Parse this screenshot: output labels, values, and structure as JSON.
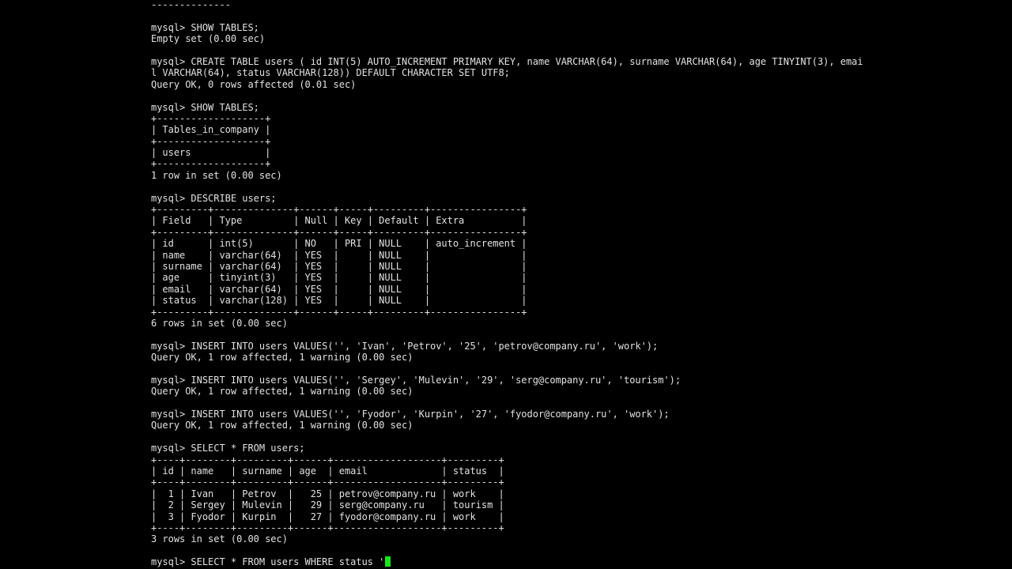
{
  "terminal": {
    "background": "#000000",
    "foreground": "#e2e2e2",
    "cursor_color": "#19e619",
    "lines": [
      "--------------",
      "",
      "mysql> SHOW TABLES;",
      "Empty set (0.00 sec)",
      "",
      "mysql> CREATE TABLE users ( id INT(5) AUTO_INCREMENT PRIMARY KEY, name VARCHAR(64), surname VARCHAR(64), age TINYINT(3), emai",
      "l VARCHAR(64), status VARCHAR(128)) DEFAULT CHARACTER SET UTF8;",
      "Query OK, 0 rows affected (0.01 sec)",
      "",
      "mysql> SHOW TABLES;",
      "+-------------------+",
      "| Tables_in_company |",
      "+-------------------+",
      "| users             |",
      "+-------------------+",
      "1 row in set (0.00 sec)",
      "",
      "mysql> DESCRIBE users;",
      "+---------+--------------+------+-----+---------+----------------+",
      "| Field   | Type         | Null | Key | Default | Extra          |",
      "+---------+--------------+------+-----+---------+----------------+",
      "| id      | int(5)       | NO   | PRI | NULL    | auto_increment |",
      "| name    | varchar(64)  | YES  |     | NULL    |                |",
      "| surname | varchar(64)  | YES  |     | NULL    |                |",
      "| age     | tinyint(3)   | YES  |     | NULL    |                |",
      "| email   | varchar(64)  | YES  |     | NULL    |                |",
      "| status  | varchar(128) | YES  |     | NULL    |                |",
      "+---------+--------------+------+-----+---------+----------------+",
      "6 rows in set (0.00 sec)",
      "",
      "mysql> INSERT INTO users VALUES('', 'Ivan', 'Petrov', '25', 'petrov@company.ru', 'work');",
      "Query OK, 1 row affected, 1 warning (0.00 sec)",
      "",
      "mysql> INSERT INTO users VALUES('', 'Sergey', 'Mulevin', '29', 'serg@company.ru', 'tourism');",
      "Query OK, 1 row affected, 1 warning (0.00 sec)",
      "",
      "mysql> INSERT INTO users VALUES('', 'Fyodor', 'Kurpin', '27', 'fyodor@company.ru', 'work');",
      "Query OK, 1 row affected, 1 warning (0.00 sec)",
      "",
      "mysql> SELECT * FROM users;",
      "+----+--------+---------+------+-------------------+---------+",
      "| id | name   | surname | age  | email             | status  |",
      "+----+--------+---------+------+-------------------+---------+",
      "|  1 | Ivan   | Petrov  |   25 | petrov@company.ru | work    |",
      "|  2 | Sergey | Mulevin |   29 | serg@company.ru   | tourism |",
      "|  3 | Fyodor | Kurpin  |   27 | fyodor@company.ru | work    |",
      "+----+--------+---------+------+-------------------+---------+",
      "3 rows in set (0.00 sec)",
      "",
      "mysql> SELECT * FROM users WHERE status '"
    ]
  }
}
